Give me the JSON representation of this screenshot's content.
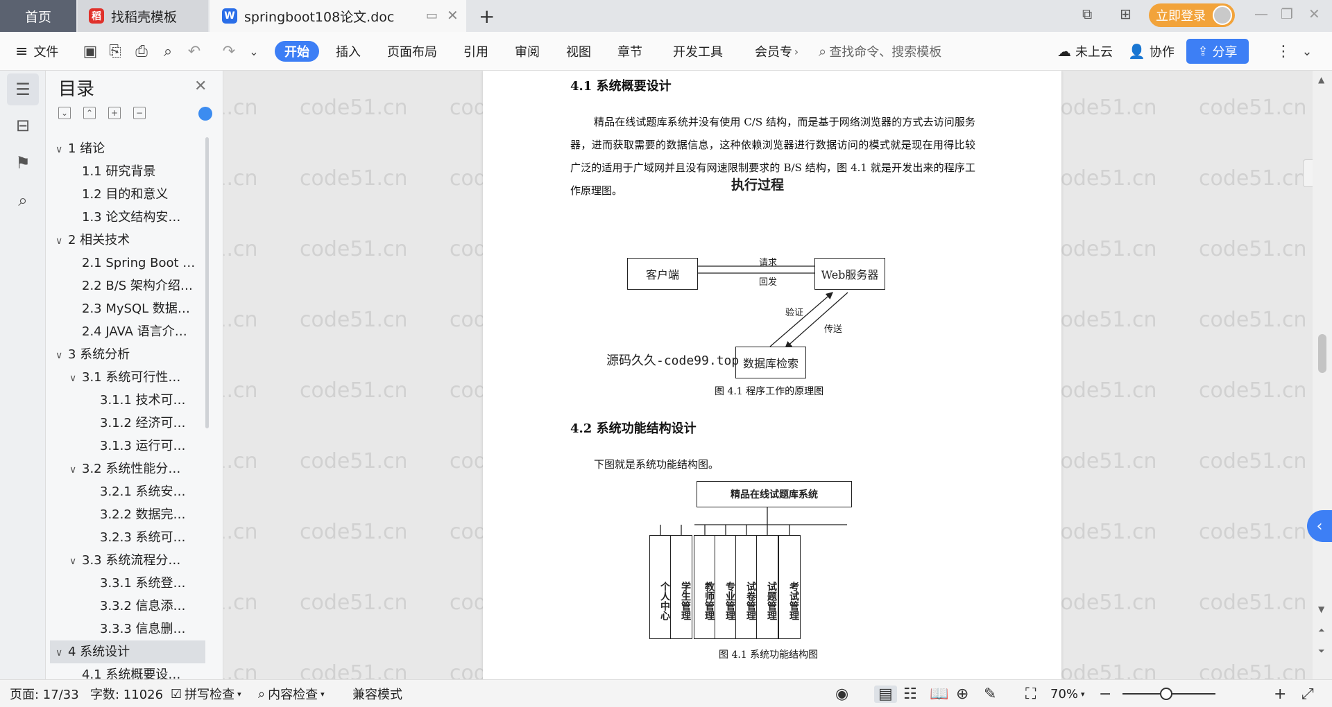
{
  "tabs": {
    "home": "首页",
    "template": "找稻壳模板",
    "doc": "springboot108论文.doc",
    "new_tab": "+"
  },
  "login": "立即登录",
  "toolbar": {
    "file": "文件",
    "start": "开始",
    "insert": "插入",
    "layout": "页面布局",
    "ref": "引用",
    "review": "审阅",
    "view": "视图",
    "chapter": "章节",
    "dev": "开发工具",
    "member": "会员专",
    "search_placeholder": "查找命令、搜索模板",
    "cloud": "未上云",
    "collab": "协作",
    "share": "分享"
  },
  "toc": {
    "title": "目录",
    "items": [
      {
        "label": "1  绪论",
        "level": 1,
        "chev": "∨"
      },
      {
        "label": "1.1  研究背景",
        "level": 2
      },
      {
        "label": "1.2 目的和意义",
        "level": 2
      },
      {
        "label": "1.3  论文结构安…",
        "level": 2
      },
      {
        "label": "2  相关技术",
        "level": 1,
        "chev": "∨"
      },
      {
        "label": "2.1 Spring Boot …",
        "level": 2
      },
      {
        "label": "2.2 B/S 架构介绍…",
        "level": 2
      },
      {
        "label": "2.3 MySQL 数据…",
        "level": 2
      },
      {
        "label": "2.4 JAVA 语言介…",
        "level": 2
      },
      {
        "label": "3  系统分析",
        "level": 1,
        "chev": "∨"
      },
      {
        "label": "3.1 系统可行性…",
        "level": 2,
        "chev": "∨"
      },
      {
        "label": "3.1.1  技术可…",
        "level": 3
      },
      {
        "label": "3.1.2  经济可…",
        "level": 3
      },
      {
        "label": "3.1.3  运行可…",
        "level": 3
      },
      {
        "label": "3.2 系统性能分…",
        "level": 2,
        "chev": "∨"
      },
      {
        "label": "3.2.1  系统安…",
        "level": 3
      },
      {
        "label": "3.2.2  数据完…",
        "level": 3
      },
      {
        "label": "3.2.3 系统可…",
        "level": 3
      },
      {
        "label": "3.3 系统流程分…",
        "level": 2,
        "chev": "∨"
      },
      {
        "label": "3.3.1 系统登…",
        "level": 3
      },
      {
        "label": "3.3.2 信息添…",
        "level": 3
      },
      {
        "label": "3.3.3 信息删…",
        "level": 3
      },
      {
        "label": "4  系统设计",
        "level": 1,
        "chev": "∨",
        "active": true
      },
      {
        "label": "4.1 系统概要设…",
        "level": 2
      }
    ]
  },
  "doc": {
    "h41": "4.1 系统概要设计",
    "p1": "精品在线试题库系统并没有使用 C/S 结构，而是基于网络浏览器的方式去访问服务器，进而获取需要的数据信息，这种依赖浏览器进行数据访问的模式就是现在用得比较广泛的适用于广域网并且没有网速限制要求的 B/S 结构，图 4.1 就是开发出来的程序工作原理图。",
    "diagram_title": "执行过程",
    "client": "客户端",
    "server": "Web服务器",
    "db": "数据库检索",
    "req": "请求",
    "resp": "回发",
    "verify": "验证",
    "send": "传送",
    "watermark_text": "源码久久-code99.top",
    "cap1": "图 4.1  程序工作的原理图",
    "h42": "4.2 系统功能结构设计",
    "p2": "下图就是系统功能结构图。",
    "root": "精品在线试题库系统",
    "leaves": [
      "个人中心",
      "学生管理",
      "教师管理",
      "专业管理",
      "试卷管理",
      "试题管理",
      "考试管理"
    ],
    "cap2": "图 4.1  系统功能结构图",
    "wm": "code51.cn"
  },
  "status": {
    "page": "页面: 17/33",
    "words": "字数: 11026",
    "spell": "拼写检查",
    "content": "内容检查",
    "compat": "兼容模式",
    "zoom": "70%"
  }
}
